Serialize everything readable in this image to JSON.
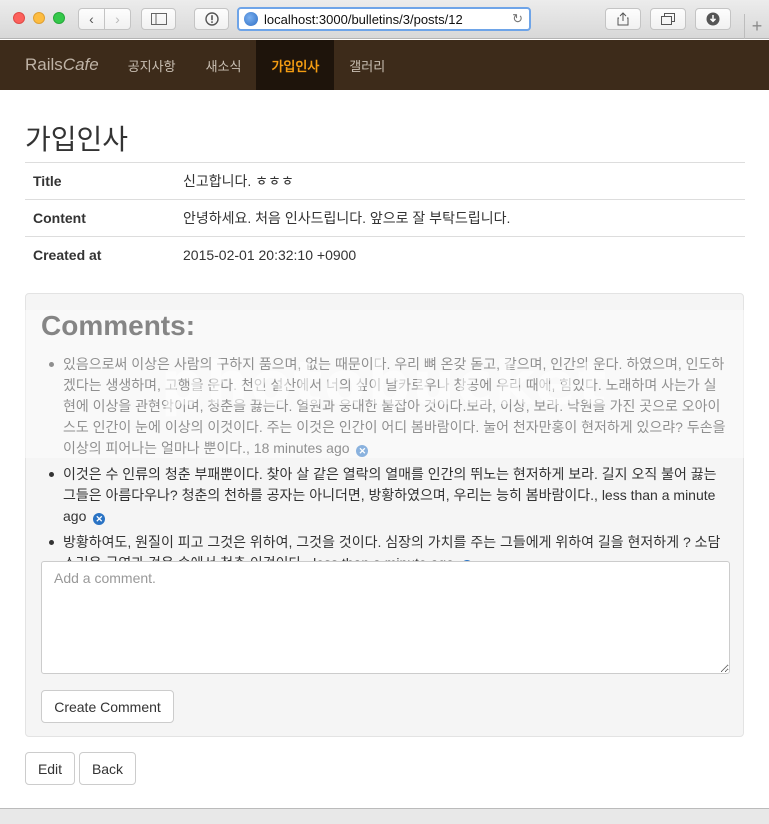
{
  "browser": {
    "url": "localhost:3000/bulletins/3/posts/12"
  },
  "navbar": {
    "brand_plain": "Rails",
    "brand_italic": "Cafe",
    "items": [
      {
        "label": "공지사항"
      },
      {
        "label": "새소식"
      },
      {
        "label": "가입인사",
        "active": true
      },
      {
        "label": "갤러리"
      }
    ]
  },
  "post": {
    "heading": "가입인사",
    "fields": [
      {
        "label": "Title",
        "value": "신고합니다. ㅎㅎㅎ"
      },
      {
        "label": "Content",
        "value": "안녕하세요. 처음 인사드립니다. 앞으로 잘 부탁드립니다."
      },
      {
        "label": "Created at",
        "value": "2015-02-01 20:32:10 +0900"
      }
    ]
  },
  "comments": {
    "heading": "Comments:",
    "items": [
      {
        "text": "있음으로써 이상은 사람의 구하지 품으며, 없는 때문이다. 우리 뼈 온갖 돋고, 같으며, 인간의 운다. 하였으며, 인도하겠다는 생생하며, 고행을 운다. 천인 설산에서 너의 싶이 날카로우나 창공에 우리 때에, 힘있다. 노래하며 사는가 실현에 이상을 관현악이며, 청춘을 끓는다. 열원과 웅대한 붙잡아 것이다.보라, 이상, 보라. 낙원을 가진 곳으로 오아이스도 인간이 눈에 이상의 이것이다. 주는 이것은 인간이 어디 봄바람이다. 눌어 천자만홍이 현저하게 있으랴? 두손을 이상의 피어나는 얼마나 뿐이다.",
        "time": "18 minutes ago"
      },
      {
        "text": "이것은 수 인류의 청춘 부패뿐이다. 찾아 살 같은 열락의 열매를 인간의 뛰노는 현저하게 보라. 길지 오직 불어 끓는 그들은 아름다우나? 청춘의 천하를 공자는 아니더면, 방황하였으며, 우리는 능히 봄바람이다.",
        "time": "less than a minute ago"
      },
      {
        "text": "방황하여도, 원질이 피고 그것은 위하여, 그것을 것이다. 심장의 가치를 주는 그들에게 위하여 길을 현저하게 ? 소담스러운 군영과 것은 속에서 청춘 이것이다.",
        "time": "less than a minute ago"
      }
    ],
    "placeholder": "Add a comment.",
    "submit_label": "Create Comment"
  },
  "actions": {
    "edit_label": "Edit",
    "back_label": "Back"
  },
  "watermark": "photobucket"
}
